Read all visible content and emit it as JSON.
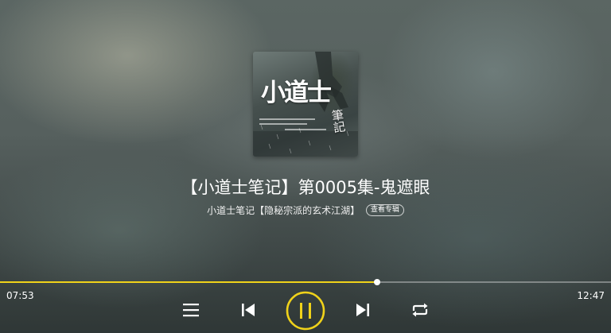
{
  "player": {
    "cover": {
      "title_text": "小道士",
      "subtitle_text": "筆記"
    },
    "track_title": "【小道士笔记】第0005集-鬼遮眼",
    "album_name": "小道士笔记【隐秘宗派的玄术江湖】",
    "album_link_label": "查看专辑",
    "progress": {
      "current_time": "07:53",
      "total_time": "12:47",
      "fraction": 0.617
    },
    "controls": {
      "playlist_icon": "list-icon",
      "previous_icon": "skip-previous-icon",
      "pause_icon": "pause-icon",
      "next_icon": "skip-next-icon",
      "repeat_icon": "repeat-icon"
    },
    "colors": {
      "accent": "#f0d21a",
      "text": "#ffffff"
    }
  }
}
